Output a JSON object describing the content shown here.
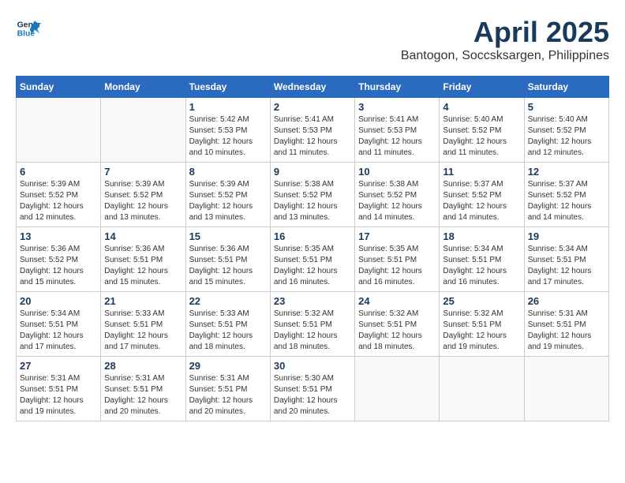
{
  "header": {
    "logo_line1": "General",
    "logo_line2": "Blue",
    "month_year": "April 2025",
    "location": "Bantogon, Soccsksargen, Philippines"
  },
  "weekdays": [
    "Sunday",
    "Monday",
    "Tuesday",
    "Wednesday",
    "Thursday",
    "Friday",
    "Saturday"
  ],
  "weeks": [
    [
      {
        "day": "",
        "info": ""
      },
      {
        "day": "",
        "info": ""
      },
      {
        "day": "1",
        "info": "Sunrise: 5:42 AM\nSunset: 5:53 PM\nDaylight: 12 hours and 10 minutes."
      },
      {
        "day": "2",
        "info": "Sunrise: 5:41 AM\nSunset: 5:53 PM\nDaylight: 12 hours and 11 minutes."
      },
      {
        "day": "3",
        "info": "Sunrise: 5:41 AM\nSunset: 5:53 PM\nDaylight: 12 hours and 11 minutes."
      },
      {
        "day": "4",
        "info": "Sunrise: 5:40 AM\nSunset: 5:52 PM\nDaylight: 12 hours and 11 minutes."
      },
      {
        "day": "5",
        "info": "Sunrise: 5:40 AM\nSunset: 5:52 PM\nDaylight: 12 hours and 12 minutes."
      }
    ],
    [
      {
        "day": "6",
        "info": "Sunrise: 5:39 AM\nSunset: 5:52 PM\nDaylight: 12 hours and 12 minutes."
      },
      {
        "day": "7",
        "info": "Sunrise: 5:39 AM\nSunset: 5:52 PM\nDaylight: 12 hours and 13 minutes."
      },
      {
        "day": "8",
        "info": "Sunrise: 5:39 AM\nSunset: 5:52 PM\nDaylight: 12 hours and 13 minutes."
      },
      {
        "day": "9",
        "info": "Sunrise: 5:38 AM\nSunset: 5:52 PM\nDaylight: 12 hours and 13 minutes."
      },
      {
        "day": "10",
        "info": "Sunrise: 5:38 AM\nSunset: 5:52 PM\nDaylight: 12 hours and 14 minutes."
      },
      {
        "day": "11",
        "info": "Sunrise: 5:37 AM\nSunset: 5:52 PM\nDaylight: 12 hours and 14 minutes."
      },
      {
        "day": "12",
        "info": "Sunrise: 5:37 AM\nSunset: 5:52 PM\nDaylight: 12 hours and 14 minutes."
      }
    ],
    [
      {
        "day": "13",
        "info": "Sunrise: 5:36 AM\nSunset: 5:52 PM\nDaylight: 12 hours and 15 minutes."
      },
      {
        "day": "14",
        "info": "Sunrise: 5:36 AM\nSunset: 5:51 PM\nDaylight: 12 hours and 15 minutes."
      },
      {
        "day": "15",
        "info": "Sunrise: 5:36 AM\nSunset: 5:51 PM\nDaylight: 12 hours and 15 minutes."
      },
      {
        "day": "16",
        "info": "Sunrise: 5:35 AM\nSunset: 5:51 PM\nDaylight: 12 hours and 16 minutes."
      },
      {
        "day": "17",
        "info": "Sunrise: 5:35 AM\nSunset: 5:51 PM\nDaylight: 12 hours and 16 minutes."
      },
      {
        "day": "18",
        "info": "Sunrise: 5:34 AM\nSunset: 5:51 PM\nDaylight: 12 hours and 16 minutes."
      },
      {
        "day": "19",
        "info": "Sunrise: 5:34 AM\nSunset: 5:51 PM\nDaylight: 12 hours and 17 minutes."
      }
    ],
    [
      {
        "day": "20",
        "info": "Sunrise: 5:34 AM\nSunset: 5:51 PM\nDaylight: 12 hours and 17 minutes."
      },
      {
        "day": "21",
        "info": "Sunrise: 5:33 AM\nSunset: 5:51 PM\nDaylight: 12 hours and 17 minutes."
      },
      {
        "day": "22",
        "info": "Sunrise: 5:33 AM\nSunset: 5:51 PM\nDaylight: 12 hours and 18 minutes."
      },
      {
        "day": "23",
        "info": "Sunrise: 5:32 AM\nSunset: 5:51 PM\nDaylight: 12 hours and 18 minutes."
      },
      {
        "day": "24",
        "info": "Sunrise: 5:32 AM\nSunset: 5:51 PM\nDaylight: 12 hours and 18 minutes."
      },
      {
        "day": "25",
        "info": "Sunrise: 5:32 AM\nSunset: 5:51 PM\nDaylight: 12 hours and 19 minutes."
      },
      {
        "day": "26",
        "info": "Sunrise: 5:31 AM\nSunset: 5:51 PM\nDaylight: 12 hours and 19 minutes."
      }
    ],
    [
      {
        "day": "27",
        "info": "Sunrise: 5:31 AM\nSunset: 5:51 PM\nDaylight: 12 hours and 19 minutes."
      },
      {
        "day": "28",
        "info": "Sunrise: 5:31 AM\nSunset: 5:51 PM\nDaylight: 12 hours and 20 minutes."
      },
      {
        "day": "29",
        "info": "Sunrise: 5:31 AM\nSunset: 5:51 PM\nDaylight: 12 hours and 20 minutes."
      },
      {
        "day": "30",
        "info": "Sunrise: 5:30 AM\nSunset: 5:51 PM\nDaylight: 12 hours and 20 minutes."
      },
      {
        "day": "",
        "info": ""
      },
      {
        "day": "",
        "info": ""
      },
      {
        "day": "",
        "info": ""
      }
    ]
  ]
}
